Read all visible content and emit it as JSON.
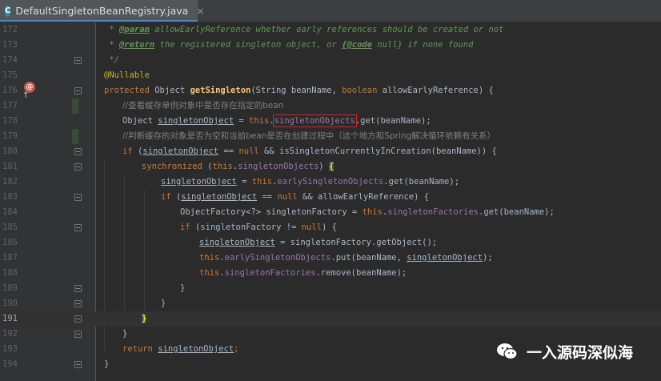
{
  "tab": {
    "filename": "DefaultSingletonBeanRegistry.java",
    "icon": "class-icon",
    "close": "×"
  },
  "watermark": {
    "text": "一入源码深似海",
    "icon": "wechat-icon"
  },
  "current_line": 191,
  "lines": [
    {
      "num": "172",
      "t1": " * ",
      "t2": "@param",
      "t3": " allowEarlyReference whether early references should be created or not"
    },
    {
      "num": "173",
      "t1": " * ",
      "t2": "@return",
      "t3": " the registered singleton object, or ",
      "t4": "{@code",
      "t5": " null} if none found"
    },
    {
      "num": "174",
      "t1": " */"
    },
    {
      "num": "175",
      "t1": "@Nullable"
    },
    {
      "num": "176",
      "t1": "protected",
      "t2": " Object ",
      "t3": "getSingleton",
      "t4": "(String beanName, ",
      "t5": "boolean",
      "t6": " allowEarlyReference) {"
    },
    {
      "num": "177",
      "t1": "//查看缓存单例对象中是否存在指定的bean"
    },
    {
      "num": "178",
      "t1": "Object ",
      "t2": "singletonObject",
      "t3": " = ",
      "t4": "this",
      "t5": ".",
      "t6": "singletonObjects",
      "t7": ".get(beanName);"
    },
    {
      "num": "179",
      "t1": "//判断缓存的对象是否为空和当前bean是否在创建过程中（这个地方和Spring解决循环依赖有关系）"
    },
    {
      "num": "180",
      "t1": "if",
      "t2": " (",
      "t3": "singletonObject",
      "t4": " == ",
      "t5": "null",
      "t6": " && isSingletonCurrentlyInCreation(beanName)) {"
    },
    {
      "num": "181",
      "t1": "synchronized",
      "t2": " (",
      "t3": "this",
      "t4": ".",
      "t5": "singletonObjects",
      "t6": ") ",
      "t7": "{"
    },
    {
      "num": "182",
      "t1": "singletonObject",
      "t2": " = ",
      "t3": "this",
      "t4": ".",
      "t5": "earlySingletonObjects",
      "t6": ".get(beanName);"
    },
    {
      "num": "183",
      "t1": "if",
      "t2": " (",
      "t3": "singletonObject",
      "t4": " == ",
      "t5": "null",
      "t6": " && allowEarlyReference) {"
    },
    {
      "num": "184",
      "t1": "ObjectFactory<?> singletonFactory = ",
      "t2": "this",
      "t3": ".",
      "t4": "singletonFactories",
      "t5": ".get(beanName);"
    },
    {
      "num": "185",
      "t1": "if",
      "t2": " (singletonFactory != ",
      "t3": "null",
      "t4": ") {"
    },
    {
      "num": "186",
      "t1": "singletonObject",
      "t2": " = singletonFactory.getObject();"
    },
    {
      "num": "187",
      "t1": "this",
      "t2": ".",
      "t3": "earlySingletonObjects",
      "t4": ".put(beanName, ",
      "t5": "singletonObject",
      "t6": ");"
    },
    {
      "num": "188",
      "t1": "this",
      "t2": ".",
      "t3": "singletonFactories",
      "t4": ".remove(beanName);"
    },
    {
      "num": "189",
      "t1": "}"
    },
    {
      "num": "190",
      "t1": "}"
    },
    {
      "num": "191",
      "t1": "}"
    },
    {
      "num": "192",
      "t1": "}"
    },
    {
      "num": "193",
      "t1": "return",
      "t2": " ",
      "t3": "singletonObject",
      "t4": ";"
    },
    {
      "num": "194",
      "t1": "}"
    }
  ]
}
